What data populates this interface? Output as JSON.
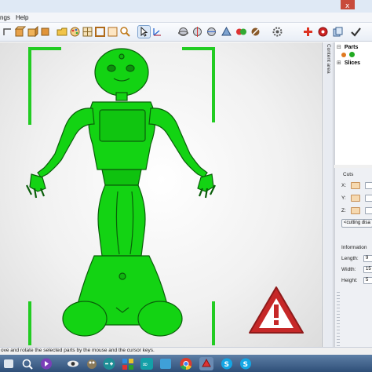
{
  "menu": {
    "items": [
      "ngs",
      "Help"
    ]
  },
  "tree": {
    "items": [
      "Parts",
      "Slices"
    ]
  },
  "dock": {
    "tab_label": "Content area"
  },
  "cuts": {
    "header": "Cuts",
    "axes": [
      "X:",
      "Y:",
      "Z:"
    ],
    "button": "<cutting disa"
  },
  "information": {
    "header": "Information",
    "rows": [
      {
        "label": "Length:",
        "value": "9"
      },
      {
        "label": "Width:",
        "value": "15"
      },
      {
        "label": "Height:",
        "value": "5"
      }
    ]
  },
  "status_text": "ove and rotate the selected parts by the mouse and the cursor keys.",
  "colors": {
    "model_green": "#13d313",
    "frame_green": "#22cc22",
    "warning_red": "#c62828",
    "taskbar": "#3a5a86"
  }
}
